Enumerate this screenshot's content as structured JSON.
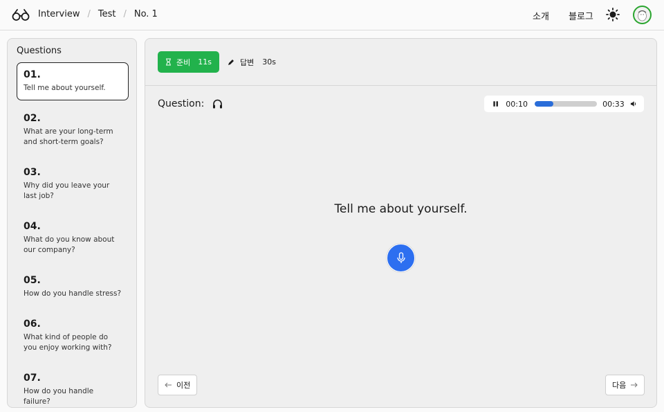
{
  "header": {
    "breadcrumbs": [
      "Interview",
      "Test",
      "No. 1"
    ],
    "nav": {
      "about": "소개",
      "blog": "블로그"
    }
  },
  "sidebar": {
    "title": "Questions",
    "items": [
      {
        "num": "01.",
        "text": "Tell me about yourself.",
        "active": true
      },
      {
        "num": "02.",
        "text": "What are your long-term and short-term goals?"
      },
      {
        "num": "03.",
        "text": "Why did you leave your last job?"
      },
      {
        "num": "04.",
        "text": "What do you know about our company?"
      },
      {
        "num": "05.",
        "text": "How do you handle stress?"
      },
      {
        "num": "06.",
        "text": "What kind of people do you enjoy working with?"
      },
      {
        "num": "07.",
        "text": "How do you handle failure?"
      }
    ]
  },
  "timer": {
    "prep_label": "준비",
    "prep_value": "11s",
    "answer_label": "답변",
    "answer_value": "30s"
  },
  "question": {
    "label": "Question:",
    "text": "Tell me about yourself."
  },
  "player": {
    "current": "00:10",
    "total": "00:33",
    "progress": 0.3
  },
  "footer": {
    "prev": "이전",
    "next": "다음"
  },
  "colors": {
    "accent_green": "#22b24c",
    "accent_blue": "#2d6ff0",
    "progress_blue": "#2a6dd9"
  }
}
